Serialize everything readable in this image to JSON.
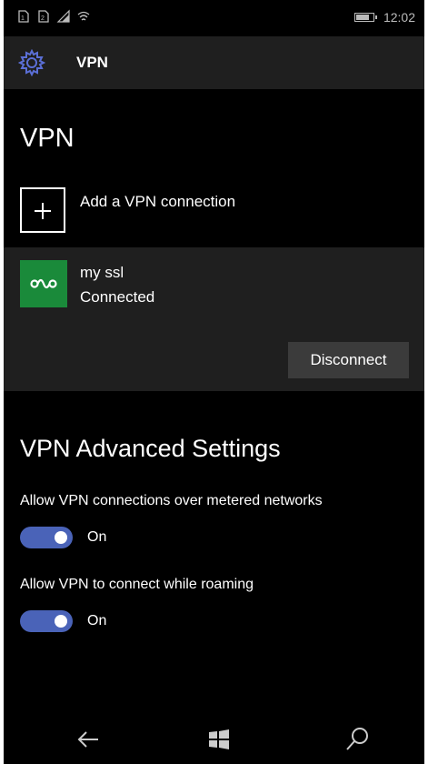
{
  "status_bar": {
    "icons": [
      "sim-card-icon",
      "sim-card-icon",
      "cellular-signal-icon",
      "wifi-icon",
      "battery-icon"
    ],
    "time": "12:02",
    "battery_level": 0.85
  },
  "header": {
    "title": "VPN",
    "icon": "gear-icon"
  },
  "page": {
    "title": "VPN"
  },
  "add_connection": {
    "label": "Add a VPN connection",
    "icon": "plus-icon"
  },
  "connection": {
    "name": "my ssl",
    "status": "Connected",
    "icon": "vpn-link-icon",
    "tile_color": "#1a8a3a",
    "disconnect_label": "Disconnect"
  },
  "advanced": {
    "title": "VPN Advanced Settings",
    "settings": [
      {
        "label": "Allow VPN connections over metered networks",
        "state": "On"
      },
      {
        "label": "Allow VPN to connect while roaming",
        "state": "On"
      }
    ],
    "accent_color": "#4a63b8"
  },
  "nav": {
    "icons": [
      "back-arrow-icon",
      "windows-start-icon",
      "search-icon"
    ]
  }
}
